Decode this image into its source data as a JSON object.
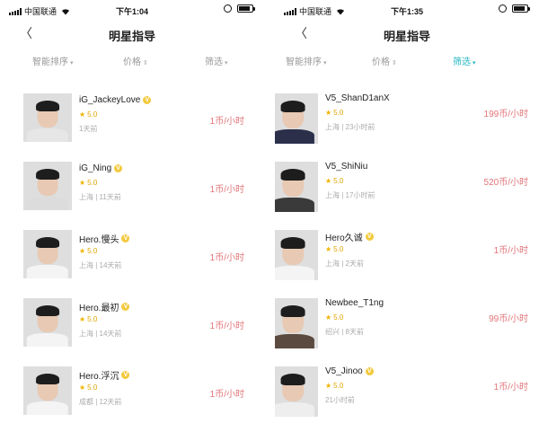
{
  "left": {
    "status": {
      "carrier": "中国联通",
      "time": "下午1:04",
      "battery_percent": 90
    },
    "nav": {
      "back_icon": "chevron-left-icon",
      "back_glyph": "〈",
      "title": "明星指导"
    },
    "filters": [
      {
        "label": "智能排序",
        "caret": "▾",
        "active": false
      },
      {
        "label": "价格",
        "caret": "⇕",
        "active": false
      },
      {
        "label": "筛选",
        "caret": "▾",
        "active": false
      }
    ],
    "items": [
      {
        "name": "iG_JackeyLove",
        "star": "★",
        "rating": "5.0",
        "meta": "1天前",
        "price": "1币/小时",
        "shirt": "#e6e6e6"
      },
      {
        "name": "iG_Ning",
        "star": "★",
        "rating": "5.0",
        "meta": "上海 | 11天前",
        "price": "1币/小时",
        "shirt": "#dcdcdc"
      },
      {
        "name": "Hero.慢头",
        "star": "★",
        "rating": "5.0",
        "meta": "上海 | 14天前",
        "price": "1币/小时",
        "shirt": "#f4f4f4"
      },
      {
        "name": "Hero.最初",
        "star": "★",
        "rating": "5.0",
        "meta": "上海 | 14天前",
        "price": "1币/小时",
        "shirt": "#f4f4f4"
      },
      {
        "name": "Hero.浮沉",
        "star": "★",
        "rating": "5.0",
        "meta": "成都 | 12天前",
        "price": "1币/小时",
        "shirt": "#f4f4f4"
      }
    ]
  },
  "right": {
    "status": {
      "carrier": "中国联通",
      "time": "下午1:35",
      "battery_percent": 90
    },
    "nav": {
      "back_icon": "chevron-left-icon",
      "back_glyph": "〈",
      "title": "明星指导"
    },
    "filters": [
      {
        "label": "智能排序",
        "caret": "▾",
        "active": false
      },
      {
        "label": "价格",
        "caret": "⇕",
        "active": false
      },
      {
        "label": "筛选",
        "caret": "▾",
        "active": true
      }
    ],
    "items": [
      {
        "name": "V5_ShanD1anX",
        "star": "★",
        "rating": "5.0",
        "meta": "上海 | 23小时前",
        "price": "199币/小时",
        "shirt": "#2b2f4a"
      },
      {
        "name": "V5_ShiNiu",
        "star": "★",
        "rating": "5.0",
        "meta": "上海 | 17小时前",
        "price": "520币/小时",
        "shirt": "#3a3a3a"
      },
      {
        "name": "Hero久诚",
        "star": "★",
        "rating": "5.0",
        "meta": "上海 | 2天前",
        "price": "1币/小时",
        "shirt": "#f4f4f4"
      },
      {
        "name": "Newbee_T1ng",
        "star": "★",
        "rating": "5.0",
        "meta": "绍兴 | 8天前",
        "price": "99币/小时",
        "shirt": "#5a4a40"
      },
      {
        "name": "V5_Jinoo",
        "star": "★",
        "rating": "5.0",
        "meta": "21小时前",
        "price": "1币/小时",
        "shirt": "#eeeeee"
      }
    ]
  },
  "colors": {
    "accent": "#25b7c4",
    "price": "#e07479",
    "star": "#f0b400",
    "verified": "#f3c93d"
  }
}
